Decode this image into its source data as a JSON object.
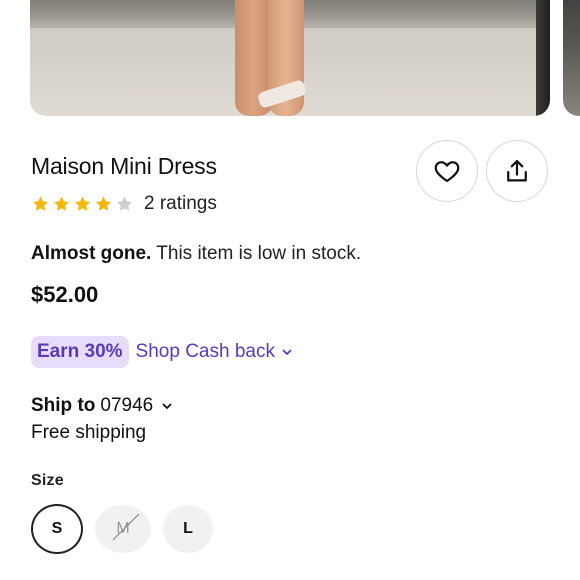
{
  "product": {
    "title": "Maison Mini Dress",
    "rating": {
      "stars_filled": 4,
      "stars_total": 5,
      "ratings_text": "2 ratings"
    },
    "stock": {
      "bold": "Almost gone.",
      "text": " This item is low in stock."
    },
    "price": "$52.00"
  },
  "actions": {
    "favorite_icon": "heart-outline-icon",
    "share_icon": "share-upload-icon"
  },
  "cashback": {
    "badge": "Earn 30%",
    "link": "Shop Cash back",
    "color": "#5a3ab8",
    "badge_bg": "#e7ddfb"
  },
  "shipping": {
    "label": "Ship to",
    "zip": "07946",
    "free_text": "Free shipping"
  },
  "size": {
    "label": "Size",
    "options": [
      {
        "label": "S",
        "selected": true,
        "available": true
      },
      {
        "label": "M",
        "selected": false,
        "available": false
      },
      {
        "label": "L",
        "selected": false,
        "available": true
      }
    ]
  },
  "colors": {
    "star": "#f0b90b",
    "star_empty": "#cfcfcf"
  }
}
